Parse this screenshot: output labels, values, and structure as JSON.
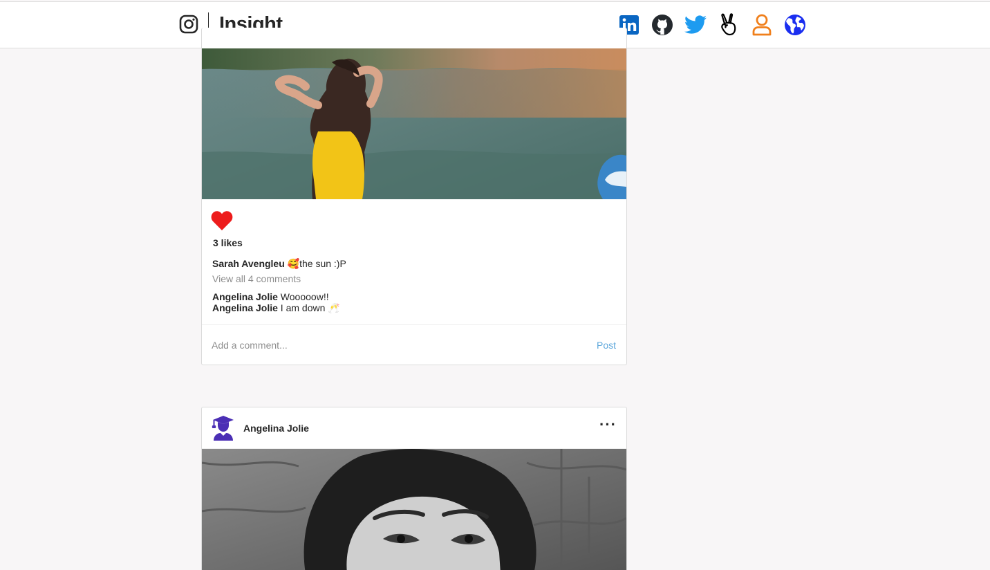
{
  "header": {
    "brand_name": "Insight",
    "brand_icon": "instagram-icon",
    "social_links": [
      {
        "icon": "linkedin-icon",
        "color": "#0a66c2"
      },
      {
        "icon": "github-icon",
        "color": "#24292e"
      },
      {
        "icon": "twitter-icon",
        "color": "#1d9bf0"
      },
      {
        "icon": "angellist-icon",
        "color": "#000000"
      },
      {
        "icon": "profile-icon",
        "color": "#f07f1b"
      },
      {
        "icon": "globe-icon",
        "color": "#1a2ef0"
      }
    ]
  },
  "feed": {
    "posts": [
      {
        "likes": "3 likes",
        "caption_author": "Sarah Avengleu",
        "caption_text": "🥰the sun :)P",
        "view_all": "View all 4 comments",
        "comments": [
          {
            "author": "Angelina Jolie",
            "text": " Wooooow!!"
          },
          {
            "author": "Angelina Jolie",
            "text": " I am down 🥂"
          }
        ],
        "comment_placeholder": "Add a comment...",
        "post_button": "Post",
        "like_color": "#ed1c1c"
      },
      {
        "author": "Angelina Jolie",
        "more_label": "···",
        "avatar_color": "#4b2fb5"
      }
    ]
  }
}
